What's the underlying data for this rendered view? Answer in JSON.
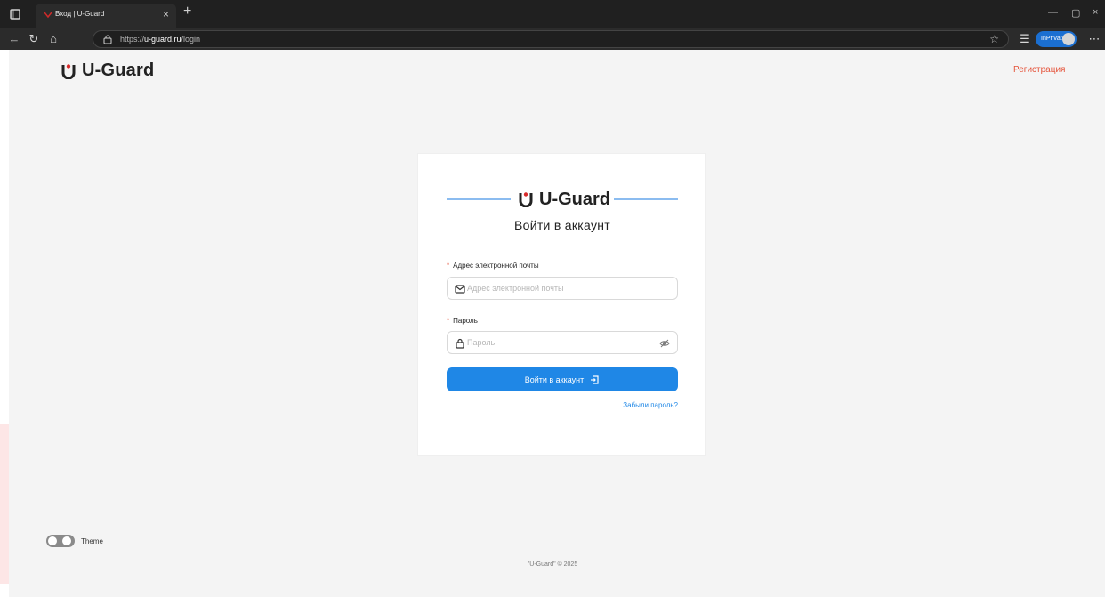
{
  "browser": {
    "tab_title": "Вход | U-Guard",
    "url_protocol": "https://",
    "url_host": "u-guard.ru",
    "url_path": "/login",
    "profile_badge": "InPrivate"
  },
  "header": {
    "brand": "U-Guard",
    "register_link": "Регистрация"
  },
  "login": {
    "brand": "U-Guard",
    "title": "Войти в аккаунт",
    "email": {
      "label": "Адрес электронной почты",
      "placeholder": "Адрес электронной почты",
      "required_mark": "*"
    },
    "password": {
      "label": "Пароль",
      "placeholder": "Пароль",
      "required_mark": "*"
    },
    "submit": "Войти в аккаунт",
    "forgot": "Забыли пароль?"
  },
  "theme": {
    "label": "Theme"
  },
  "footer": {
    "text": "\"U-Guard\" © 2025"
  },
  "colors": {
    "primary": "#1f87e6",
    "danger": "#e5533a",
    "line": "#8bbcf0",
    "page_bg": "#f4f4f4"
  }
}
